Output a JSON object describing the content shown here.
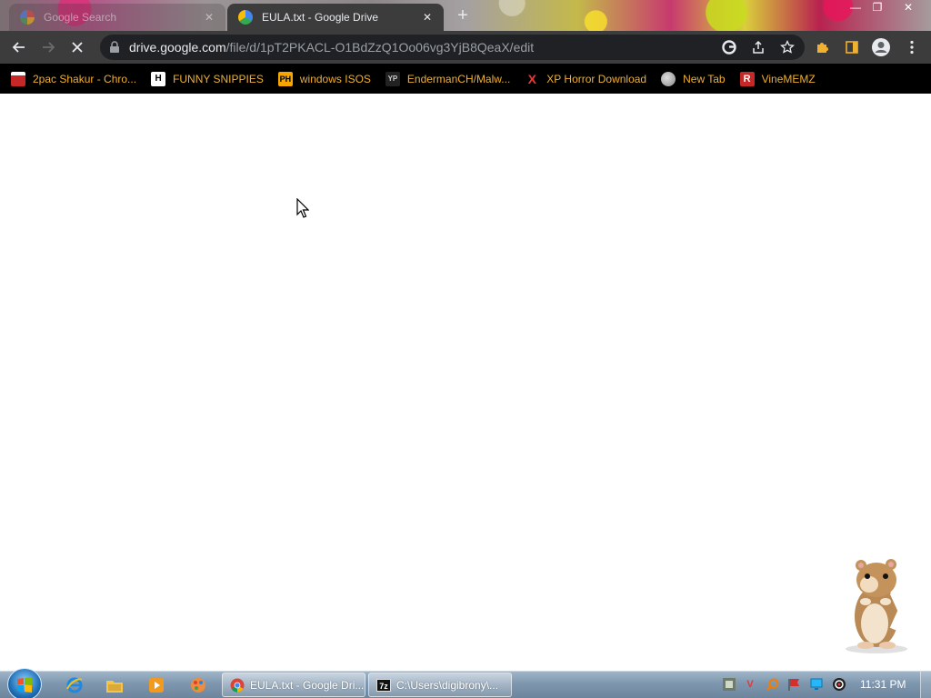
{
  "browser": {
    "tabs": [
      {
        "title": "Google Search",
        "active": false,
        "favicon": "google-icon"
      },
      {
        "title": "EULA.txt - Google Drive",
        "active": true,
        "favicon": "google-drive-icon"
      }
    ],
    "close_glyph": "✕",
    "new_tab_glyph": "+",
    "window_controls": {
      "minimize": "—",
      "maximize": "❐",
      "close": "✕"
    },
    "address_bar": {
      "host": "drive.google.com",
      "path": "/file/d/1pT2PKACL-O1BdZzQ1Oo06vg3YjB8QeaX/edit"
    },
    "bookmarks": [
      {
        "label": "2pac Shakur - Chro...",
        "icon": "calendar-icon"
      },
      {
        "label": "FUNNY SNIPPIES",
        "icon": "h-icon",
        "glyph": "H"
      },
      {
        "label": "windows ISOS",
        "icon": "ph-icon",
        "glyph": "PH"
      },
      {
        "label": "EndermanCH/Malw...",
        "icon": "youtube-premium-icon",
        "glyph": "YP"
      },
      {
        "label": "XP Horror Download",
        "icon": "x-icon",
        "glyph": "X"
      },
      {
        "label": "New Tab",
        "icon": "globe-icon"
      },
      {
        "label": "VineMEMZ",
        "icon": "r-icon",
        "glyph": "R"
      }
    ]
  },
  "taskbar": {
    "tasks": [
      {
        "label": "EULA.txt - Google Dri...",
        "icon": "chrome-icon"
      },
      {
        "label": "C:\\Users\\digibrony\\...",
        "icon": "7zip-icon",
        "glyph": "7z"
      }
    ],
    "clock": "11:31 PM"
  },
  "colors": {
    "bookmark_text": "#f0b030",
    "toolbar": "#3c3c3c",
    "omnibox": "#202124"
  }
}
